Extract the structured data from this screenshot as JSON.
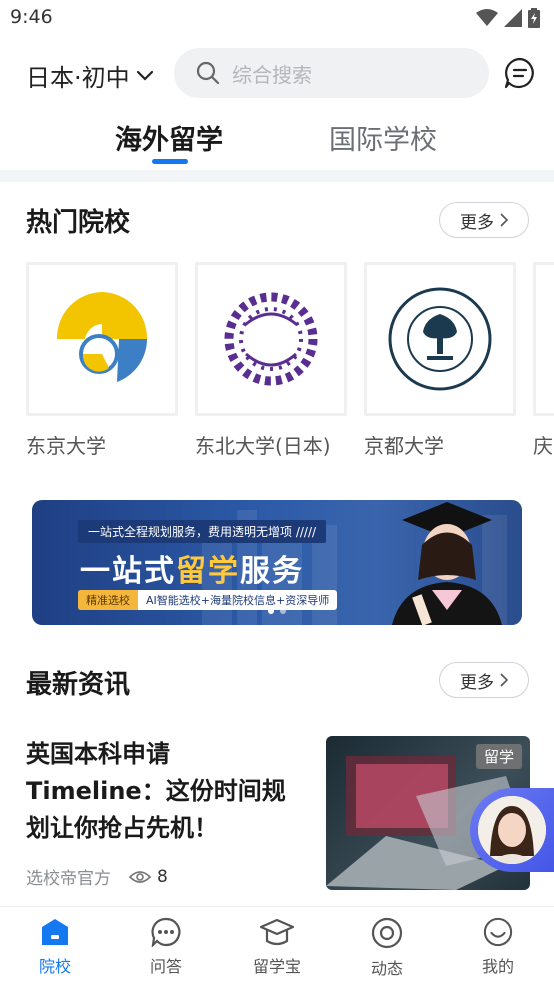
{
  "status_bar": {
    "time": "9:46"
  },
  "header": {
    "region_label": "日本·初中",
    "search_placeholder": "综合搜索"
  },
  "tabs": [
    {
      "label": "海外留学",
      "active": true
    },
    {
      "label": "国际学校",
      "active": false
    }
  ],
  "hot_schools": {
    "title": "热门院校",
    "more_label": "更多",
    "items": [
      {
        "name": "东京大学"
      },
      {
        "name": "东北大学(日本)"
      },
      {
        "name": "京都大学"
      },
      {
        "name": "庆"
      }
    ]
  },
  "banner": {
    "top_text": "一站式全程规划服务，费用透明无增项 /////",
    "title_part1": "一站式",
    "title_highlight": "留学",
    "title_part2": "服务",
    "tag": "精准选校",
    "subtitle": "AI智能选校+海量院校信息+资深导师"
  },
  "news": {
    "title": "最新资讯",
    "more_label": "更多",
    "items": [
      {
        "title": "英国本科申请Timeline：这份时间规划让你抢占先机！",
        "source": "选校帝官方",
        "views": "8",
        "badge": "留学"
      }
    ]
  },
  "bottom_nav": [
    {
      "label": "院校",
      "icon": "school-icon",
      "active": true
    },
    {
      "label": "问答",
      "icon": "chat-bubble-icon",
      "active": false
    },
    {
      "label": "留学宝",
      "icon": "graduation-cap-icon",
      "active": false
    },
    {
      "label": "动态",
      "icon": "target-icon",
      "active": false
    },
    {
      "label": "我的",
      "icon": "smile-icon",
      "active": false
    }
  ],
  "colors": {
    "accent": "#1478f0",
    "banner_highlight": "#ffc83d"
  }
}
